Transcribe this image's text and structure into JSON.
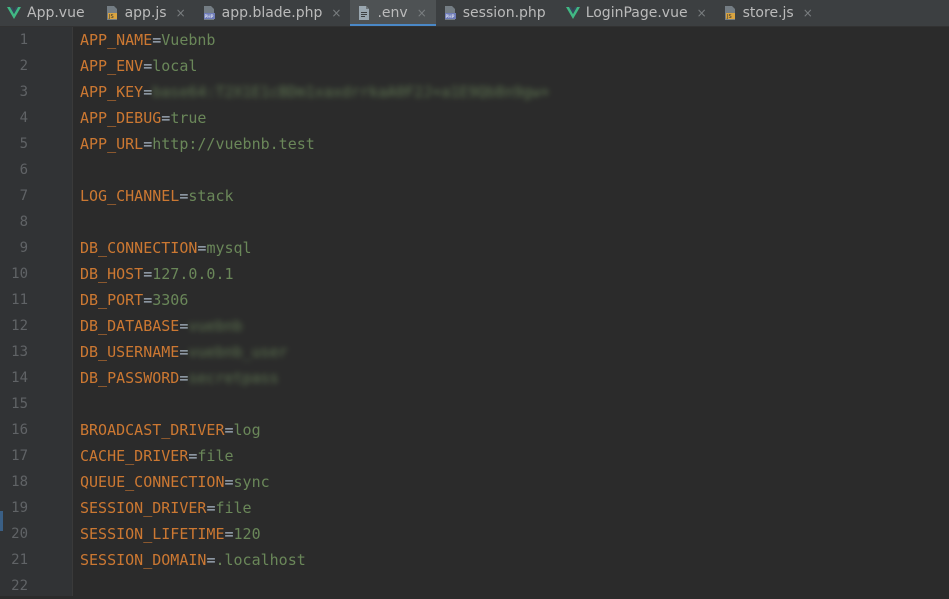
{
  "tabs": [
    {
      "label": "App.vue",
      "icon": "vue-icon",
      "active": false,
      "closable": false
    },
    {
      "label": "app.js",
      "icon": "js-file-icon",
      "active": false,
      "closable": true
    },
    {
      "label": "app.blade.php",
      "icon": "php-file-icon",
      "active": false,
      "closable": true
    },
    {
      "label": ".env",
      "icon": "text-file-icon",
      "active": true,
      "closable": true
    },
    {
      "label": "session.php",
      "icon": "php-file-icon",
      "active": false,
      "closable": false
    },
    {
      "label": "LoginPage.vue",
      "icon": "vue-icon",
      "active": false,
      "closable": true
    },
    {
      "label": "store.js",
      "icon": "js-file-icon",
      "active": false,
      "closable": true
    }
  ],
  "tab_close_glyph": "×",
  "equals_sign": "=",
  "editor": {
    "lines": [
      {
        "num": "1",
        "key": "APP_NAME",
        "value": "Vuebnb",
        "blurred": false
      },
      {
        "num": "2",
        "key": "APP_ENV",
        "value": "local",
        "blurred": false
      },
      {
        "num": "3",
        "key": "APP_KEY",
        "value": "base64:T2X1E1cBDm1xaxdrrkaA0F2J+a1E9Qb8n9gw+",
        "blurred": true
      },
      {
        "num": "4",
        "key": "APP_DEBUG",
        "value": "true",
        "blurred": false
      },
      {
        "num": "5",
        "key": "APP_URL",
        "value": "http://vuebnb.test",
        "blurred": false
      },
      {
        "num": "6",
        "key": "",
        "value": "",
        "blurred": false
      },
      {
        "num": "7",
        "key": "LOG_CHANNEL",
        "value": "stack",
        "blurred": false
      },
      {
        "num": "8",
        "key": "",
        "value": "",
        "blurred": false
      },
      {
        "num": "9",
        "key": "DB_CONNECTION",
        "value": "mysql",
        "blurred": false
      },
      {
        "num": "10",
        "key": "DB_HOST",
        "value": "127.0.0.1",
        "blurred": false
      },
      {
        "num": "11",
        "key": "DB_PORT",
        "value": "3306",
        "blurred": false
      },
      {
        "num": "12",
        "key": "DB_DATABASE",
        "value": "vuebnb",
        "blurred": true
      },
      {
        "num": "13",
        "key": "DB_USERNAME",
        "value": "vuebnb_user",
        "blurred": true
      },
      {
        "num": "14",
        "key": "DB_PASSWORD",
        "value": "secretpass",
        "blurred": true
      },
      {
        "num": "15",
        "key": "",
        "value": "",
        "blurred": false
      },
      {
        "num": "16",
        "key": "BROADCAST_DRIVER",
        "value": "log",
        "blurred": false
      },
      {
        "num": "17",
        "key": "CACHE_DRIVER",
        "value": "file",
        "blurred": false
      },
      {
        "num": "18",
        "key": "QUEUE_CONNECTION",
        "value": "sync",
        "blurred": false
      },
      {
        "num": "19",
        "key": "SESSION_DRIVER",
        "value": "file",
        "blurred": false
      },
      {
        "num": "20",
        "key": "SESSION_LIFETIME",
        "value": "120",
        "blurred": false
      },
      {
        "num": "21",
        "key": "SESSION_DOMAIN",
        "value": ".localhost",
        "blurred": false
      },
      {
        "num": "22",
        "key": "",
        "value": "",
        "blurred": false
      }
    ]
  },
  "colors": {
    "background": "#2b2b2b",
    "gutter": "#313335",
    "tabbar": "#3c3f41",
    "active_tab_underline": "#4a88c7",
    "key": "#cc7832",
    "value": "#6a8759",
    "line_number": "#606366"
  }
}
